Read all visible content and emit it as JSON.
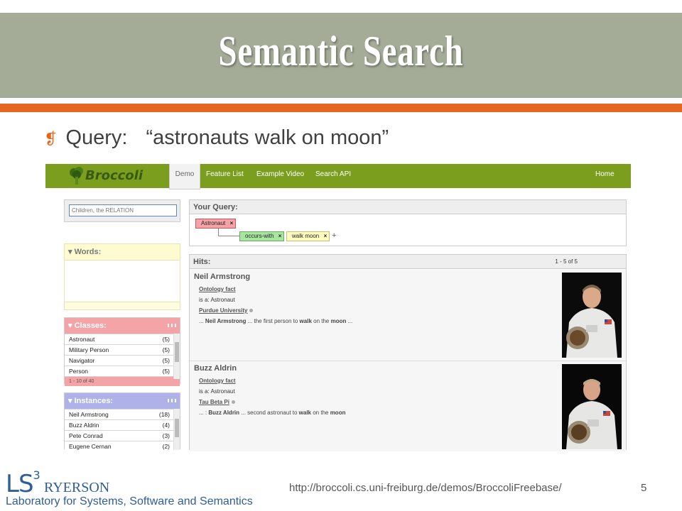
{
  "slide": {
    "title": "Semantic Search",
    "query_label": "Query:",
    "query_text": "“astronauts walk on moon”",
    "footer_url": "http://broccoli.cs.uni-freiburg.de/demos/BroccoliFreebase/",
    "page_number": "5",
    "logo_ls": "LS",
    "logo_sup": "3",
    "logo_ryerson": "RYERSON",
    "lab_name": "Laboratory for Systems, Software and Semantics"
  },
  "app": {
    "logo_text": "Broccoli",
    "nav": [
      "Demo",
      "Feature List",
      "Example Video",
      "Search API",
      "Home"
    ],
    "search_placeholder": "Children, the RELATION",
    "words_panel": {
      "title": "▾ Words:"
    },
    "classes_panel": {
      "title": "▾ Classes:",
      "rows": [
        {
          "name": "Astronaut",
          "count": "(5)"
        },
        {
          "name": "Military Person",
          "count": "(5)"
        },
        {
          "name": "Navigator",
          "count": "(5)"
        },
        {
          "name": "Person",
          "count": "(5)"
        }
      ],
      "footer": "1 - 10 of 40"
    },
    "instances_panel": {
      "title": "▾ Instances:",
      "rows": [
        {
          "name": "Neil Armstrong",
          "count": "(18)"
        },
        {
          "name": "Buzz Aldrin",
          "count": "(4)"
        },
        {
          "name": "Pete Conrad",
          "count": "(3)"
        },
        {
          "name": "Eugene Cernan",
          "count": "(2)"
        }
      ]
    },
    "query_panel": {
      "title": "Your Query:",
      "chip_class": "Astronaut",
      "chip_relation": "occurs-with",
      "chip_words": "walk moon",
      "close_glyph": "×",
      "plus": "+"
    },
    "hits_panel": {
      "title": "Hits:",
      "range": "1 - 5 of 5",
      "hits": [
        {
          "name": "Neil Armstrong",
          "fact_link": "Ontology fact",
          "fact": "is a: Astronaut",
          "context_link": "Purdue University",
          "snippet_pre": "... ",
          "snippet_entity": "Neil Armstrong",
          "snippet_mid": " ... the first person to ",
          "snippet_w1": "walk",
          "snippet_mid2": " on the ",
          "snippet_w2": "moon",
          "snippet_end": " ..."
        },
        {
          "name": "Buzz Aldrin",
          "fact_link": "Ontology fact",
          "fact": "is a: Astronaut",
          "context_link": "Tau Beta Pi",
          "snippet_pre": "... : ",
          "snippet_entity": "Buzz Aldrin",
          "snippet_mid": " ... second astronaut to ",
          "snippet_w1": "walk",
          "snippet_mid2": " on the ",
          "snippet_w2": "moon",
          "snippet_end": ""
        }
      ]
    }
  },
  "colors": {
    "title_band": "#a4ac98",
    "accent_orange": "#e4671d",
    "nav_green": "#7b9e1e",
    "classes_pink": "#f4a3a6",
    "instances_lavender": "#aeb2e8",
    "logo_blue": "#2f5d9a"
  }
}
